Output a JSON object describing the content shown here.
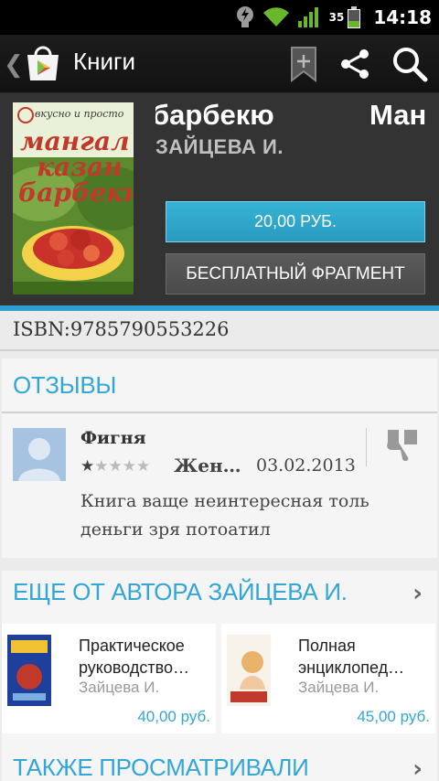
{
  "status_bar": {
    "battery_level": "35",
    "time": "14:18"
  },
  "action_bar": {
    "title": "Книги"
  },
  "book": {
    "title": "барбекю",
    "title_marquee_tail": "Ман",
    "author": "ЗАЙЦЕВА И.",
    "cover_text_top": "вкусно и просто",
    "cover_text_1": "мангал",
    "cover_text_2": "казан",
    "cover_text_3": "барбекю",
    "buy_label": "20,00 РУБ.",
    "sample_label": "БЕСПЛАТНЫЙ ФРАГМЕНТ",
    "isbn": "ISBN:9785790553226"
  },
  "reviews": {
    "header": "ОТЗЫВЫ",
    "items": [
      {
        "title": "Фигня",
        "rating": 1,
        "rating_max": 5,
        "author": "Жен…",
        "date": "03.02.2013",
        "text": "Книга ваще неинтересная толь деньги зря потоатил"
      }
    ]
  },
  "more_by_author": {
    "header": "ЕЩЕ ОТ АВТОРА ЗАЙЦЕВА И.",
    "items": [
      {
        "title": "Практическое руководство…",
        "author": "Зайцева И.",
        "price": "40,00 руб."
      },
      {
        "title": "Полная энциклопед…",
        "author": "Зайцева И.",
        "price": "45,00 руб."
      }
    ]
  },
  "also_viewed": {
    "header": "ТАКЖЕ ПРОСМАТРИВАЛИ"
  },
  "colors": {
    "accent": "#33a6d8",
    "buy_button": "#2ea6cc",
    "header_bg": "#333333"
  },
  "icons": [
    "back-arrow-icon",
    "play-store-logo-icon",
    "bookmark-add-icon",
    "share-icon",
    "search-icon",
    "thumbs-down-icon",
    "chevron-right-icon",
    "wifi-icon",
    "signal-icon",
    "battery-icon",
    "flash-icon"
  ]
}
